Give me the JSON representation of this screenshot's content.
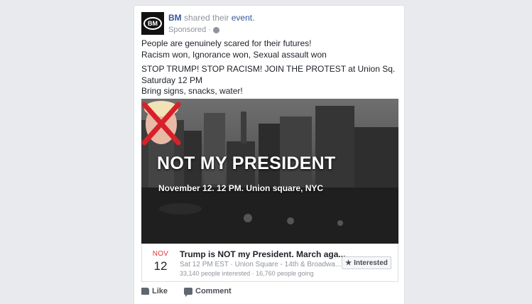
{
  "post": {
    "author": "BM",
    "action_text": "shared their",
    "action_link": "event.",
    "sponsored_label": "Sponsored",
    "separator": "·",
    "avatar_text": "BM",
    "text_lines": [
      "People are genuinely scared for their futures!",
      "Racism won, Ignorance won, Sexual assault won",
      "STOP TRUMP! STOP RACISM! JOIN THE PROTEST at Union Sq.",
      "Saturday 12 PM",
      "Bring signs, snacks, water!"
    ]
  },
  "image": {
    "title": "NOT MY PRESIDENT",
    "subtitle": "November 12. 12 PM. Union square, NYC",
    "x_mark_color": "#d7212a"
  },
  "event": {
    "month": "NOV",
    "day": "12",
    "title": "Trump is NOT my President. March aga...",
    "meta": "Sat 12 PM EST · Union Square - 14th & Broadwa...",
    "stats": "33,140 people interested · 16,760 people going",
    "interested_label": "Interested",
    "star_icon": "★"
  },
  "actions": {
    "like_label": "Like",
    "comment_label": "Comment"
  },
  "colors": {
    "link": "#365899",
    "month": "#e0393e",
    "background": "#e9eaed"
  }
}
